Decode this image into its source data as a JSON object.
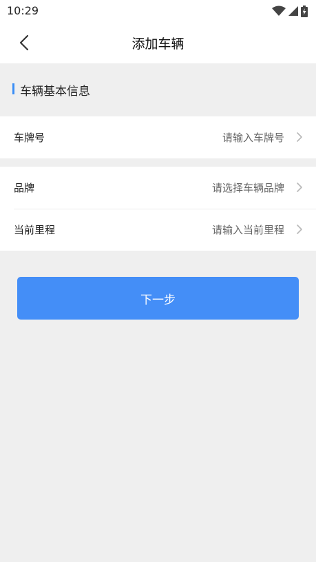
{
  "status_bar": {
    "time": "10:29"
  },
  "nav": {
    "title": "添加车辆"
  },
  "section": {
    "title": "车辆基本信息"
  },
  "fields": [
    {
      "label": "车牌号",
      "placeholder": "请输入车牌号"
    },
    {
      "label": "品牌",
      "placeholder": "请选择车辆品牌"
    },
    {
      "label": "当前里程",
      "placeholder": "请输入当前里程"
    }
  ],
  "actions": {
    "next_label": "下一步"
  },
  "colors": {
    "accent": "#3a8ef6",
    "button": "#448ef7",
    "background": "#efefef"
  }
}
